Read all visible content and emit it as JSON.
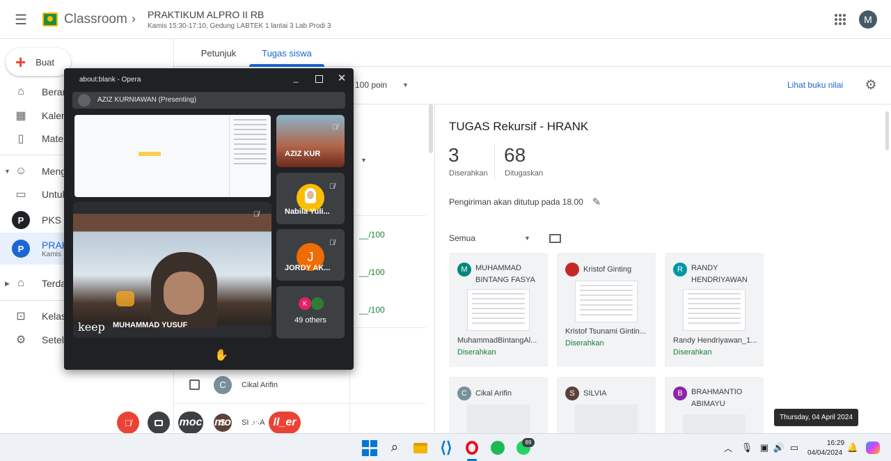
{
  "app": {
    "name": "Classroom",
    "user_initial": "M"
  },
  "course": {
    "title": "PRAKTIKUM ALPRO II RB",
    "subtitle": "Kamis 15:30-17:10, Gedung LABTEK 1 lantai 3 Lab Prodi 3"
  },
  "sidebar": {
    "create_label": "Buat",
    "items": [
      {
        "label": "Beran"
      },
      {
        "label": "Kalen"
      },
      {
        "label": "Mater"
      },
      {
        "label": "Meng"
      },
      {
        "label": "Untuk"
      },
      {
        "label": "PKS II",
        "initial": "P"
      },
      {
        "label": "PRAK",
        "sub": "Kamis",
        "initial": "P"
      },
      {
        "label": "Terda"
      },
      {
        "label": "Kelas"
      },
      {
        "label": "Setela"
      }
    ]
  },
  "tabs": [
    {
      "label": "Petunjuk"
    },
    {
      "label": "Tugas siswa"
    }
  ],
  "toolbar": {
    "points": "100 poin",
    "gradebook_link": "Lihat buku nilai"
  },
  "student_list": {
    "scores": [
      "__/100",
      "__/100",
      "__/100"
    ],
    "rows": [
      {
        "name": "Cikal Arifin",
        "initial": "C"
      },
      {
        "name": "SILVIA",
        "initial": "S"
      }
    ]
  },
  "assignment": {
    "title": "TUGAS Rekursif - HRANK",
    "submitted_count": "3",
    "submitted_label": "Diserahkan",
    "assigned_count": "68",
    "assigned_label": "Ditugaskan",
    "deadline": "Pengiriman akan ditutup pada 18.00",
    "filter": "Semua"
  },
  "cards": [
    {
      "name": "MUHAMMAD BINTANG FASYA",
      "initial": "M",
      "file": "MuhammadBintangAl...",
      "status": "Diserahkan",
      "color": "#00897b"
    },
    {
      "name": "Kristof Ginting",
      "initial": "",
      "file": "Kristof Tsunami Gintin...",
      "status": "Diserahkan",
      "color": "#c62828"
    },
    {
      "name": "RANDY HENDRIYAWAN",
      "initial": "R",
      "file": "Randy Hendriyawan_1...",
      "status": "Diserahkan",
      "color": "#0097a7"
    },
    {
      "name": "Cikal Arifin",
      "initial": "C",
      "color": "#78909c"
    },
    {
      "name": "SILVIA",
      "initial": "S",
      "color": "#5d4037"
    },
    {
      "name": "BRAHMANTIO ABIMAYU",
      "initial": "B",
      "color": "#8e24aa"
    }
  ],
  "popup": {
    "window_title": "about:blank - Opera",
    "presenter": "AZIZ KURNIAWAN (Presenting)",
    "main_name": "MUHAMMAD YUSUF",
    "keep_label": "keep",
    "participants": [
      {
        "name": "AZIZ KUR"
      },
      {
        "name": "Nabila Yuli..."
      },
      {
        "name": "JORDY AK...",
        "initial": "J"
      },
      {
        "name": "49 others",
        "initials": [
          "K",
          ""
        ]
      }
    ],
    "controls_text": [
      "moc",
      "more_ve",
      "ll_er"
    ]
  },
  "tooltip": "Thursday, 04 April 2024",
  "clock": {
    "time": "16:29",
    "date": "04/04/2024"
  },
  "whatsapp_badge": "89",
  "colors": {
    "accent": "#1967d2",
    "green": "#188038",
    "meet_red": "#ea4335"
  }
}
